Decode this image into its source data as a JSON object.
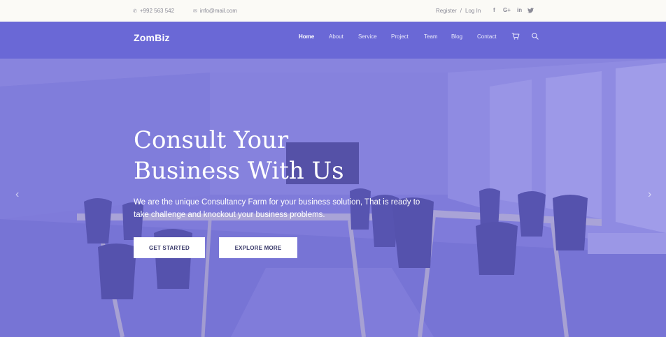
{
  "topbar": {
    "phone": "+992 563 542",
    "email": "info@mail.com",
    "register": "Register",
    "separator": "/",
    "login": "Log In",
    "social": {
      "facebook": "f",
      "google": "G+",
      "linkedin": "in"
    }
  },
  "nav": {
    "brand": "ZomBiz",
    "items": [
      "Home",
      "About",
      "Service",
      "Project",
      "Team",
      "Blog",
      "Contact"
    ]
  },
  "hero": {
    "title_line1": "Consult Your",
    "title_line2": "Business With Us",
    "text": "We are the unique Consultancy Farm for your business solution, That is ready to take challenge and knockout your business problems.",
    "btn_start": "GET STARTED",
    "btn_explore": "EXPLORE MORE",
    "arrow_left": "‹",
    "arrow_right": "›"
  },
  "colors": {
    "accent": "#6a68d6",
    "topbar": "#fbfaf6"
  }
}
